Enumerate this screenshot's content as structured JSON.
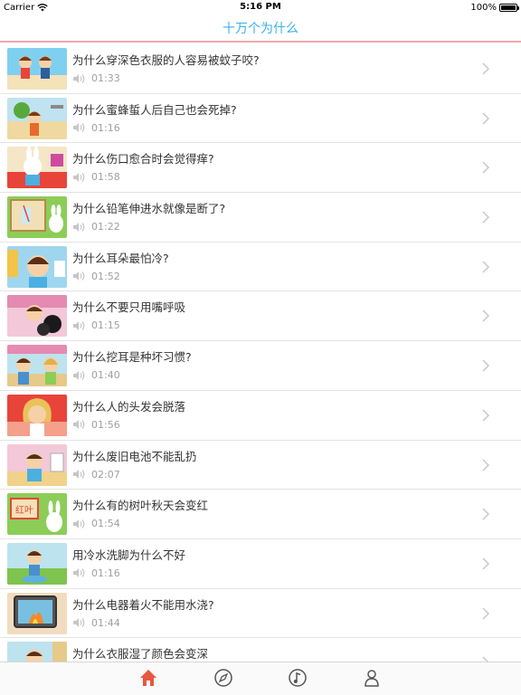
{
  "status": {
    "carrier": "Carrier",
    "time": "5:16 PM",
    "battery": "100%"
  },
  "header": {
    "title": "十万个为什么"
  },
  "items": [
    {
      "title": "为什么穿深色衣服的人容易被蚊子咬?",
      "duration": "01:33"
    },
    {
      "title": "为什么蜜蜂蜇人后自己也会死掉?",
      "duration": "01:16"
    },
    {
      "title": "为什么伤口愈合时会觉得痒?",
      "duration": "01:58"
    },
    {
      "title": "为什么铅笔伸进水就像是断了?",
      "duration": "01:22"
    },
    {
      "title": "为什么耳朵最怕冷?",
      "duration": "01:52"
    },
    {
      "title": "为什么不要只用嘴呼吸",
      "duration": "01:15"
    },
    {
      "title": "为什么挖耳是种坏习惯?",
      "duration": "01:40"
    },
    {
      "title": "为什么人的头发会脱落",
      "duration": "01:56"
    },
    {
      "title": "为什么废旧电池不能乱扔",
      "duration": "02:07"
    },
    {
      "title": "为什么有的树叶秋天会变红",
      "duration": "01:54"
    },
    {
      "title": "用冷水洗脚为什么不好",
      "duration": "01:16"
    },
    {
      "title": "为什么电器着火不能用水浇?",
      "duration": "01:44"
    },
    {
      "title": "为什么衣服湿了颜色会变深",
      "duration": ""
    }
  ],
  "thumb_label_hongye": "红叶",
  "tabs": [
    {
      "icon": "home-icon",
      "active": true
    },
    {
      "icon": "compass-icon",
      "active": false
    },
    {
      "icon": "music-icon",
      "active": false
    },
    {
      "icon": "person-icon",
      "active": false
    }
  ],
  "colors": {
    "title": "#3ab0e8",
    "accent_line": "#f2a7a7",
    "active_tab": "#e8573f",
    "inactive_tab": "#555555"
  }
}
